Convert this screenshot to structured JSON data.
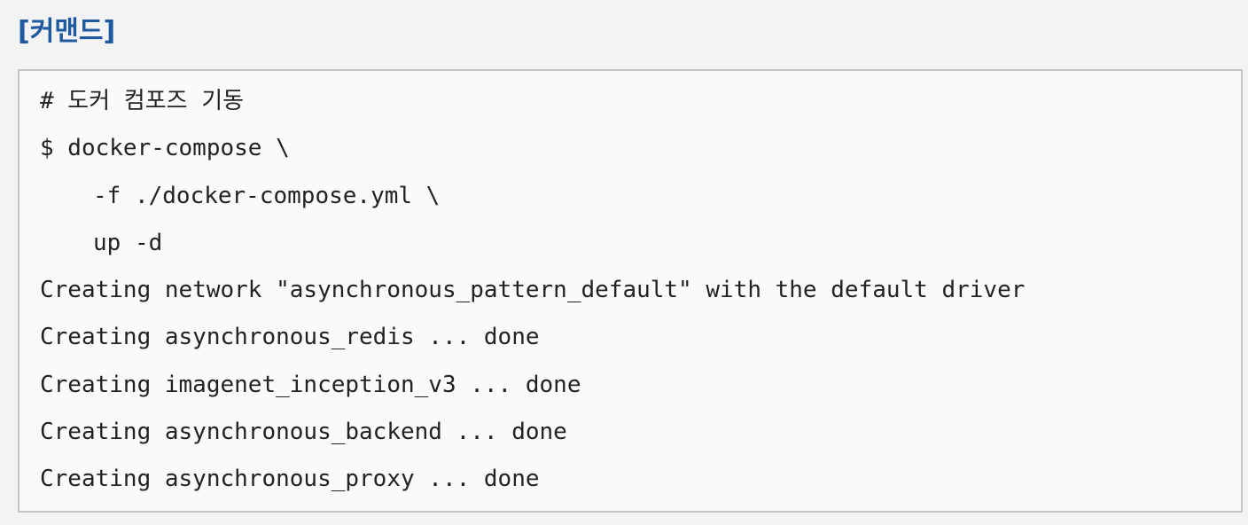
{
  "section_label": "[커맨드]",
  "code_block": {
    "lines": [
      {
        "text": "# 도커 컴포즈 기동",
        "indent": false
      },
      {
        "text": "$ docker-compose \\",
        "indent": false
      },
      {
        "text": "-f ./docker-compose.yml \\",
        "indent": true
      },
      {
        "text": "up -d",
        "indent": true
      },
      {
        "text": "Creating network \"asynchronous_pattern_default\" with the default driver",
        "indent": false
      },
      {
        "text": "Creating asynchronous_redis ... done",
        "indent": false
      },
      {
        "text": "Creating imagenet_inception_v3 ... done",
        "indent": false
      },
      {
        "text": "Creating asynchronous_backend ... done",
        "indent": false
      },
      {
        "text": "Creating asynchronous_proxy ... done",
        "indent": false
      }
    ]
  },
  "colors": {
    "label": "#1f5aa0",
    "code_text": "#222222",
    "box_border": "#c4c4c4",
    "box_background": "#fafafa",
    "page_background": "#f3f3f3"
  }
}
